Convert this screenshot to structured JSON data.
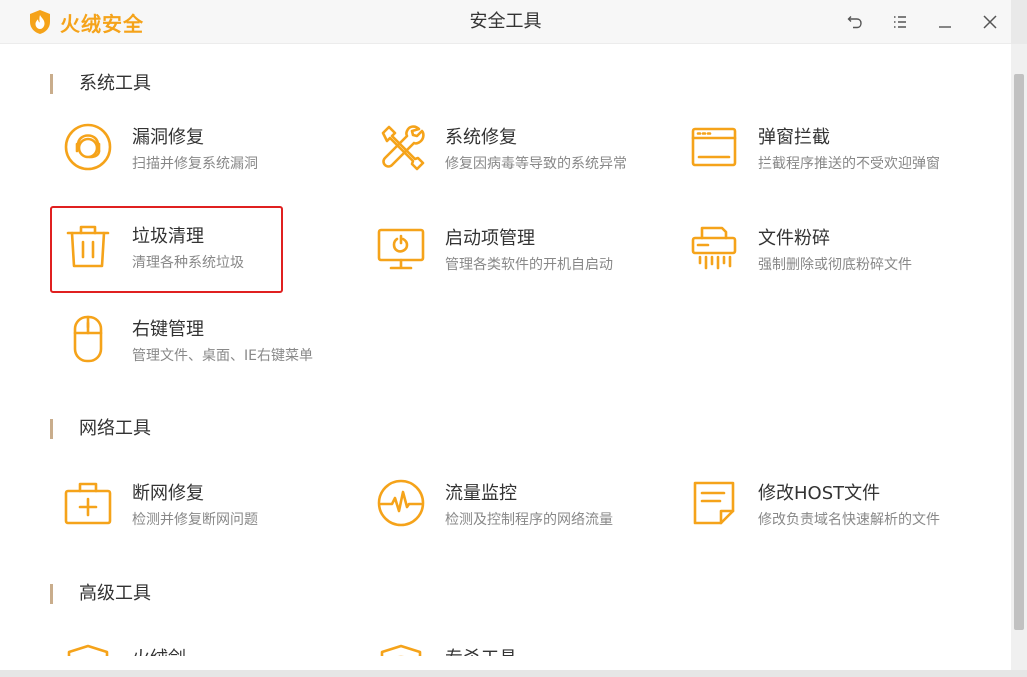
{
  "app": {
    "brand": "火绒安全",
    "window_title": "安全工具"
  },
  "colors": {
    "accent": "#f5a31a",
    "selection": "#e02020",
    "section_bar": "#c9ad8c"
  },
  "sections": [
    {
      "title": "系统工具"
    },
    {
      "title": "网络工具"
    },
    {
      "title": "高级工具"
    }
  ],
  "system_tools": [
    {
      "icon": "bug-fix-icon",
      "name": "漏洞修复",
      "desc": "扫描并修复系统漏洞"
    },
    {
      "icon": "wrench-screwdriver-icon",
      "name": "系统修复",
      "desc": "修复因病毒等导致的系统异常"
    },
    {
      "icon": "popup-window-icon",
      "name": "弹窗拦截",
      "desc": "拦截程序推送的不受欢迎弹窗"
    },
    {
      "icon": "trash-icon",
      "name": "垃圾清理",
      "desc": "清理各种系统垃圾",
      "selected": true
    },
    {
      "icon": "monitor-startup-icon",
      "name": "启动项管理",
      "desc": "管理各类软件的开机自启动"
    },
    {
      "icon": "shredder-icon",
      "name": "文件粉碎",
      "desc": "强制删除或彻底粉碎文件"
    },
    {
      "icon": "mouse-icon",
      "name": "右键管理",
      "desc": "管理文件、桌面、IE右键菜单"
    }
  ],
  "network_tools": [
    {
      "icon": "first-aid-kit-icon",
      "name": "断网修复",
      "desc": "检测并修复断网问题"
    },
    {
      "icon": "traffic-monitor-icon",
      "name": "流量监控",
      "desc": "检测及控制程序的网络流量"
    },
    {
      "icon": "host-file-icon",
      "name": "修改HOST文件",
      "desc": "修改负责域名快速解析的文件"
    }
  ],
  "advanced_tools": [
    {
      "icon": "shield-sword-icon",
      "name": "火绒剑"
    },
    {
      "icon": "shield-tool-icon",
      "name": "专杀工具"
    }
  ]
}
